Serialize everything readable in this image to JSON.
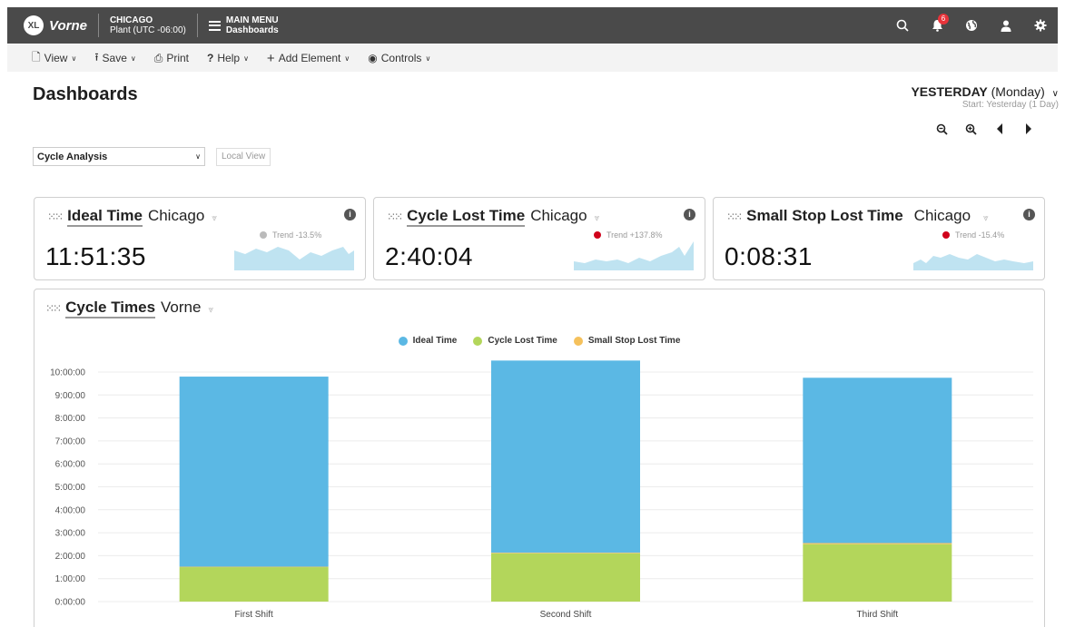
{
  "app": {
    "logo_badge": "XL",
    "logo_text": "Vorne",
    "location_line1": "CHICAGO",
    "location_line2": "Plant (UTC -06:00)",
    "menu_line1": "MAIN MENU",
    "menu_line2": "Dashboards",
    "notification_count": "6",
    "icons": [
      "search-icon",
      "bell-icon",
      "globe-icon",
      "user-icon",
      "gear-icon"
    ]
  },
  "toolbar": {
    "view": "View",
    "save": "Save",
    "print": "Print",
    "help": "Help",
    "add_element": "Add Element",
    "controls": "Controls"
  },
  "page": {
    "title": "Dashboards",
    "date_bold": "YESTERDAY",
    "date_rest": " (Monday)",
    "date_sub": "Start: Yesterday (1 Day)",
    "dashboard_select": "Cycle Analysis",
    "local_view": "Local View"
  },
  "cards": [
    {
      "title": "Ideal Time",
      "location": "Chicago",
      "value": "11:51:35",
      "trend": "Trend -13.5%",
      "trend_color": "#bbbbbb"
    },
    {
      "title": "Cycle Lost Time",
      "location": "Chicago",
      "value": "2:40:04",
      "trend": "Trend +137.8%",
      "trend_color": "#d0021b"
    },
    {
      "title": "Small Stop Lost Time",
      "location": "Chicago",
      "value": "0:08:31",
      "trend": "Trend -15.4%",
      "trend_color": "#d0021b"
    }
  ],
  "panel": {
    "title": "Cycle Times",
    "location": "Vorne"
  },
  "colors": {
    "ideal": "#5bb8e4",
    "cycle_lost": "#b3d65b",
    "small_stop": "#f5c15c",
    "spark": "#bfe3f1"
  },
  "chart_data": {
    "type": "bar",
    "stacked": true,
    "categories": [
      "First Shift",
      "Second Shift",
      "Third Shift"
    ],
    "series": [
      {
        "name": "Cycle Lost Time",
        "values": [
          1.5,
          2.1,
          2.5
        ],
        "unit": "hours"
      },
      {
        "name": "Small Stop Lost Time",
        "values": [
          0.02,
          0.03,
          0.05
        ],
        "unit": "hours"
      },
      {
        "name": "Ideal Time",
        "values": [
          8.28,
          8.37,
          7.2
        ],
        "unit": "hours"
      }
    ],
    "yticks": [
      "0:00:00",
      "1:00:00",
      "2:00:00",
      "3:00:00",
      "4:00:00",
      "5:00:00",
      "6:00:00",
      "7:00:00",
      "8:00:00",
      "9:00:00",
      "10:00:00"
    ],
    "ylim": [
      0,
      10
    ],
    "legend": [
      "Ideal Time",
      "Cycle Lost Time",
      "Small Stop Lost Time"
    ],
    "legend_position": "top-center",
    "grid": true
  }
}
